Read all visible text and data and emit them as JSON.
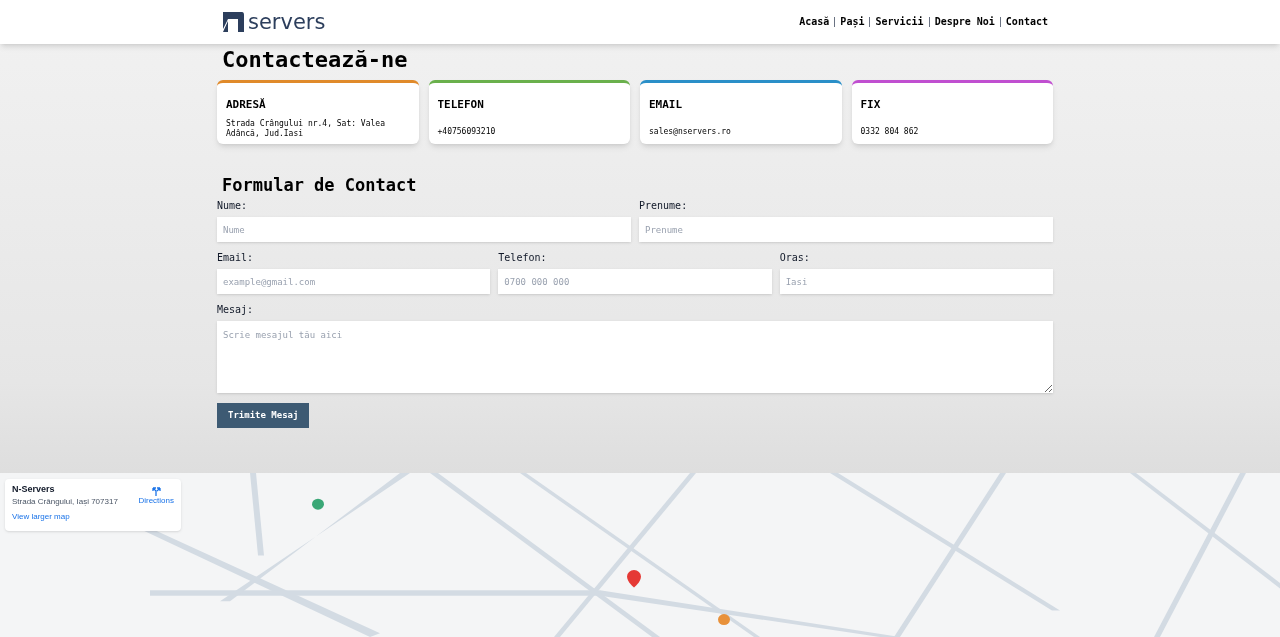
{
  "header": {
    "logo": "servers",
    "nav": [
      {
        "label": "Acasă"
      },
      {
        "label": "Pași"
      },
      {
        "label": "Servicii"
      },
      {
        "label": "Despre Noi"
      },
      {
        "label": "Contact"
      }
    ]
  },
  "title": "Contactează-ne",
  "cards": [
    {
      "title": "ADRESĂ",
      "text": "Strada Crângului nr.4, Sat: Valea Adâncă, Jud.Iasi",
      "color": "#e08a2a"
    },
    {
      "title": "TELEFON",
      "text": "+40756093210",
      "color": "#6ab04c"
    },
    {
      "title": "EMAIL",
      "text": "sales@nservers.ro",
      "color": "#2a8fc8"
    },
    {
      "title": "FIX",
      "text": "0332 804 862",
      "color": "#c04fd0"
    }
  ],
  "form": {
    "title": "Formular de Contact",
    "rows": [
      [
        {
          "label": "Nume:",
          "placeholder": "Nume",
          "kind": "input"
        },
        {
          "label": "Prenume:",
          "placeholder": "Prenume",
          "kind": "input"
        }
      ],
      [
        {
          "label": "Email:",
          "placeholder": "example@gmail.com",
          "kind": "input"
        },
        {
          "label": "Telefon:",
          "placeholder": "0700 000 000",
          "kind": "input"
        },
        {
          "label": "Oras:",
          "placeholder": "Iasi",
          "kind": "input"
        }
      ],
      [
        {
          "label": "Mesaj:",
          "placeholder": "Scrie mesajul tău aici",
          "kind": "textarea"
        }
      ]
    ],
    "button": "Trimite Mesaj"
  },
  "map": {
    "kind": "picture",
    "card": {
      "title": "N-Servers",
      "address": "Strada Crângului, Iași 707317",
      "directions": "Directions",
      "link": "View larger map"
    }
  }
}
